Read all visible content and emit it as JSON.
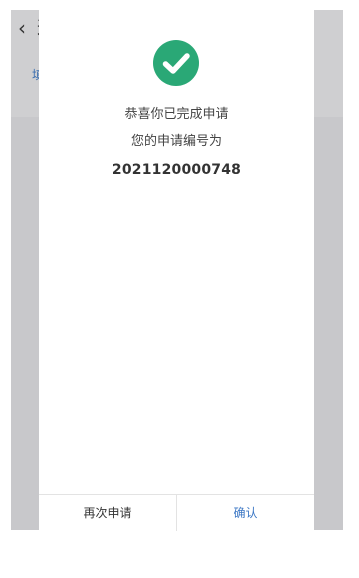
{
  "background_screen": {
    "back_glyph": "‹",
    "title_fragment": "这",
    "link_fragment": "填"
  },
  "dialog": {
    "icon": "check-circle-icon",
    "icon_color": "#2aa876",
    "congrats_text": "恭喜你已完成申请",
    "number_label": "您的申请编号为",
    "application_number": "2021120000748",
    "buttons": {
      "reapply": "再次申请",
      "confirm": "确认"
    },
    "confirm_color": "#3a76c4"
  }
}
